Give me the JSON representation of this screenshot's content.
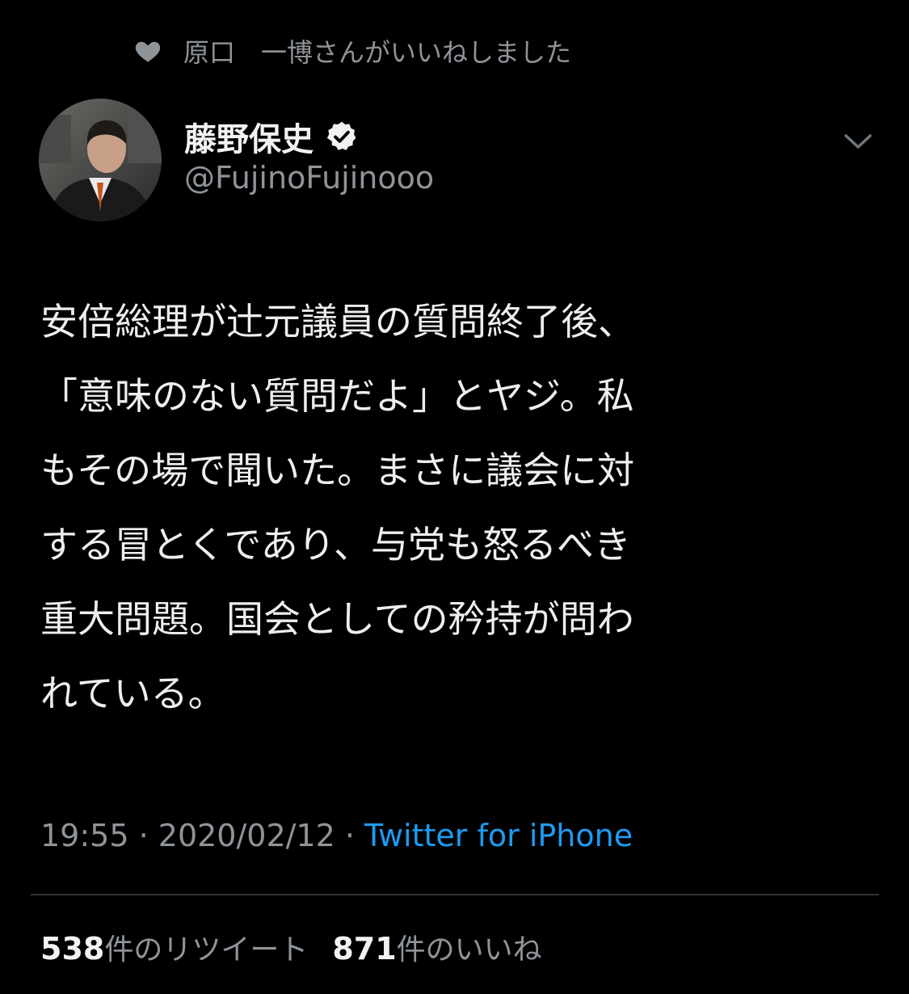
{
  "context": {
    "icon": "heart-icon",
    "text": "原口　一博さんがいいねしました"
  },
  "author": {
    "name": "藤野保史",
    "handle": "@FujinoFujinooo",
    "verified": true
  },
  "tweet": {
    "lines": [
      "安倍総理が辻元議員の質問終了後、",
      "「意味のない質問だよ」とヤジ。私",
      "もその場で聞いた。まさに議会に対",
      "する冒とくであり、与党も怒るべき",
      "重大問題。国会としての矜持が問わ",
      "れている。"
    ]
  },
  "meta": {
    "time": "19:55",
    "separator": " · ",
    "date": "2020/02/12",
    "source": "Twitter for iPhone"
  },
  "stats": {
    "retweets": "538",
    "retweets_label": "件のリツイート",
    "likes": "871",
    "likes_label": "件のいいね"
  },
  "colors": {
    "background": "#000000",
    "text": "#eeeeee",
    "muted": "#8f9499",
    "link": "#1d9bf0",
    "divider": "#2f3336"
  }
}
